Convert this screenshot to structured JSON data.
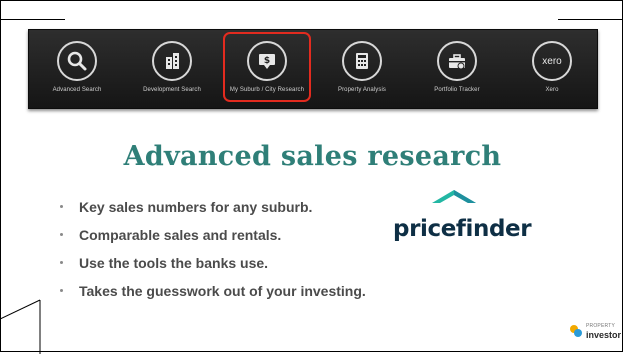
{
  "toolbar": {
    "items": [
      {
        "icon": "search-icon",
        "label": "Advanced Search"
      },
      {
        "icon": "buildings-icon",
        "label": "Development Search"
      },
      {
        "icon": "sales-report-icon",
        "label": "My Suburb / City Research"
      },
      {
        "icon": "calculator-icon",
        "label": "Property Analysis"
      },
      {
        "icon": "briefcase-icon",
        "label": "Portfolio Tracker"
      },
      {
        "icon": "xero-icon",
        "label": "Xero"
      }
    ],
    "selected_index": 2,
    "xero_text": "xero"
  },
  "headline": "Advanced sales research",
  "bullets": [
    "Key sales numbers for any suburb.",
    "Comparable sales and rentals.",
    "Use the tools the banks use.",
    "Takes the guesswork out of your investing."
  ],
  "brand": {
    "name": "pricefinder",
    "mark_color": "#23b7a4",
    "text_color": "#0e2f45"
  },
  "footer_logo": {
    "top": "PROPERTY",
    "main": "investor"
  },
  "colors": {
    "headline": "#2f7f78",
    "highlight": "#e32b1f"
  }
}
